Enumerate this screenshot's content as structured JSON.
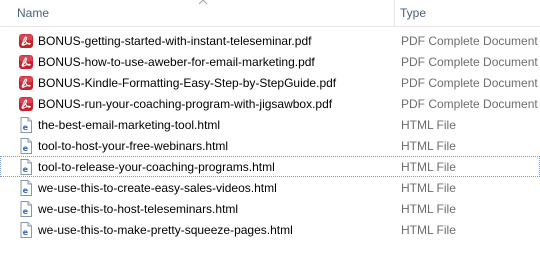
{
  "columns": {
    "name": "Name",
    "type": "Type"
  },
  "files": [
    {
      "name": "BONUS-getting-started-with-instant-teleseminar.pdf",
      "type": "PDF Complete Document",
      "icon": "pdf-icon"
    },
    {
      "name": "BONUS-how-to-use-aweber-for-email-marketing.pdf",
      "type": "PDF Complete Document",
      "icon": "pdf-icon"
    },
    {
      "name": "BONUS-Kindle-Formatting-Easy-Step-by-StepGuide.pdf",
      "type": "PDF Complete Document",
      "icon": "pdf-icon"
    },
    {
      "name": "BONUS-run-your-coaching-program-with-jigsawbox.pdf",
      "type": "PDF Complete Document",
      "icon": "pdf-icon"
    },
    {
      "name": "the-best-email-marketing-tool.html",
      "type": "HTML File",
      "icon": "html-file-icon"
    },
    {
      "name": "tool-to-host-your-free-webinars.html",
      "type": "HTML File",
      "icon": "html-file-icon"
    },
    {
      "name": "tool-to-release-your-coaching-programs.html",
      "type": "HTML File",
      "icon": "html-file-icon"
    },
    {
      "name": "we-use-this-to-create-easy-sales-videos.html",
      "type": "HTML File",
      "icon": "html-file-icon"
    },
    {
      "name": "we-use-this-to-host-teleseminars.html",
      "type": "HTML File",
      "icon": "html-file-icon"
    },
    {
      "name": "we-use-this-to-make-pretty-squeeze-pages.html",
      "type": "HTML File",
      "icon": "html-file-icon"
    }
  ]
}
